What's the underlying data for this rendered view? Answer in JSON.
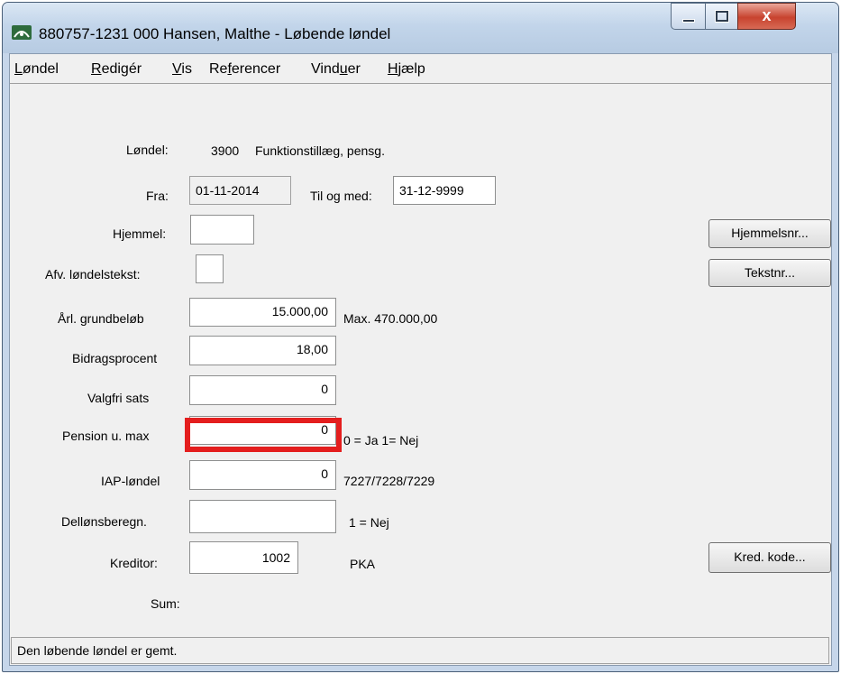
{
  "window": {
    "title": "880757-1231 000 Hansen, Malthe - Løbende løndel",
    "close_glyph": "x"
  },
  "menu": [
    {
      "label": "Løndel",
      "mnemonic": "L"
    },
    {
      "label": "Redigér",
      "mnemonic": "R"
    },
    {
      "label": "Vis",
      "mnemonic": "V"
    },
    {
      "label": "Referencer",
      "mnemonic": "f"
    },
    {
      "label": "Vinduer",
      "mnemonic": "u"
    },
    {
      "label": "Hjælp",
      "mnemonic": "H"
    }
  ],
  "form": {
    "loendel_label": "Løndel:",
    "loendel_code": "3900",
    "loendel_name": "Funktionstillæg, pensg.",
    "fra_label": "Fra:",
    "fra_value": "01-11-2014",
    "til_label": "Til og med:",
    "til_value": "31-12-9999",
    "hjemmel_label": "Hjemmel:",
    "hjemmel_value": "",
    "afv_label": "Afv. løndelstekst:",
    "afv_value": "",
    "grundbeloeb_label": "Årl. grundbeløb",
    "grundbeloeb_value": "15.000,00",
    "grundbeloeb_hint": "Max. 470.000,00",
    "bidrag_label": "Bidragsprocent",
    "bidrag_value": "18,00",
    "valgfri_label": "Valgfri sats",
    "valgfri_value": "0",
    "pension_label": "Pension u. max",
    "pension_value": "0",
    "pension_hint": "0 = Ja 1= Nej",
    "iap_label": "IAP-løndel",
    "iap_value": "0",
    "iap_hint": "7227/7228/7229",
    "dellons_label": "Dellønsberegn.",
    "dellons_value": "",
    "dellons_hint": "1 = Nej",
    "kreditor_label": "Kreditor:",
    "kreditor_value": "1002",
    "kreditor_name": "PKA",
    "sum_label": "Sum:"
  },
  "buttons": {
    "hjemmelsnr": "Hjemmelsnr...",
    "tekstnr": "Tekstnr...",
    "kred_kode": "Kred. kode..."
  },
  "status": {
    "text": "Den løbende løndel er gemt."
  },
  "colors": {
    "highlight": "#e41e1e"
  }
}
